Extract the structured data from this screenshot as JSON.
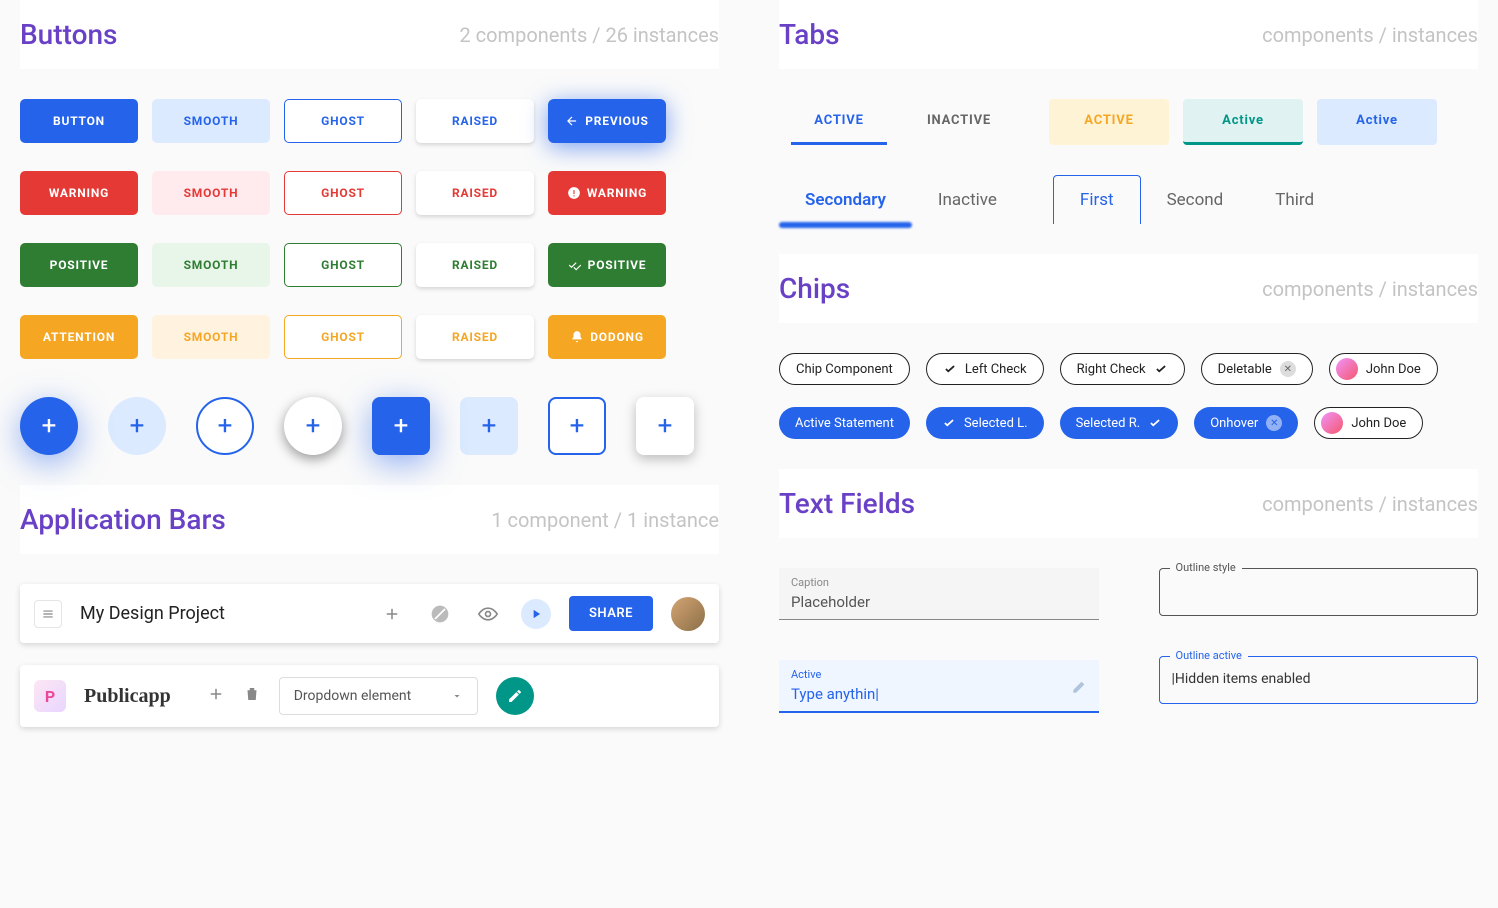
{
  "sections": {
    "buttons": {
      "title": "Buttons",
      "meta": "2 components  / 26 instances"
    },
    "appbars": {
      "title": "Application Bars",
      "meta": "1 component  / 1 instance"
    },
    "tabs": {
      "title": "Tabs",
      "meta": "components  / instances"
    },
    "chips": {
      "title": "Chips",
      "meta": "components  / instances"
    },
    "textfields": {
      "title": "Text Fields",
      "meta": "components  / instances"
    }
  },
  "buttons": {
    "blue": {
      "solid": "BUTTON",
      "smooth": "SMOOTH",
      "ghost": "GHOST",
      "raised": "RAISED",
      "icon": "PREVIOUS"
    },
    "red": {
      "solid": "WARNING",
      "smooth": "SMOOTH",
      "ghost": "GHOST",
      "raised": "RAISED",
      "icon": "WARNING"
    },
    "green": {
      "solid": "POSITIVE",
      "smooth": "SMOOTH",
      "ghost": "GHOST",
      "raised": "RAISED",
      "icon": "POSITIVE"
    },
    "amber": {
      "solid": "ATTENTION",
      "smooth": "SMOOTH",
      "ghost": "GHOST",
      "raised": "RAISED",
      "icon": "DODONG"
    }
  },
  "appbar1": {
    "title": "My Design Project",
    "share": "SHARE"
  },
  "appbar2": {
    "logo": "P",
    "brand": "Publicapp",
    "dropdown": "Dropdown element"
  },
  "tabs1": {
    "active": "ACTIVE",
    "inactive": "INACTIVE",
    "amber": "ACTIVE",
    "teal": "Active",
    "light": "Active"
  },
  "tabs2": {
    "secondary": "Secondary",
    "inactive": "Inactive",
    "first": "First",
    "second": "Second",
    "third": "Third"
  },
  "chips": {
    "row1": {
      "component": "Chip Component",
      "leftcheck": "Left Check",
      "rightcheck": "Right Check",
      "deletable": "Deletable",
      "person": "John Doe"
    },
    "row2": {
      "active": "Active Statement",
      "selectedl": "Selected L.",
      "selectedr": "Selected R.",
      "onhover": "Onhover",
      "person": "John Doe"
    }
  },
  "textfields": {
    "filled1": {
      "caption": "Caption",
      "value": "Placeholder"
    },
    "filled2": {
      "caption": "Active",
      "value": "Type anythin|"
    },
    "outline1": {
      "legend": "Outline style"
    },
    "outline2": {
      "legend": "Outline active",
      "value": "|Hidden items enabled"
    }
  }
}
